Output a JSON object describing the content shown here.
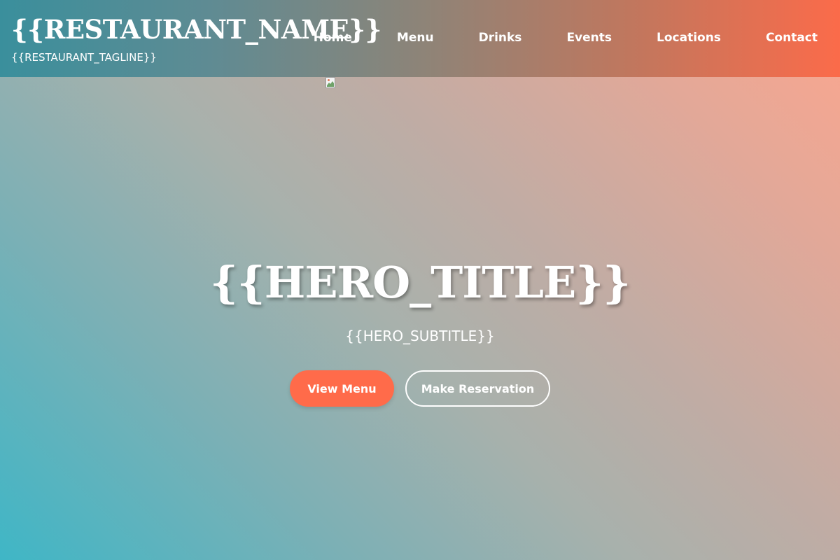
{
  "header": {
    "restaurant_name": "{{RESTAURANT_NAME}}",
    "tagline": "{{RESTAURANT_TAGLINE}}",
    "nav": [
      {
        "label": "Home"
      },
      {
        "label": "Menu"
      },
      {
        "label": "Drinks"
      },
      {
        "label": "Events"
      },
      {
        "label": "Locations"
      },
      {
        "label": "Contact"
      }
    ]
  },
  "hero": {
    "title": "{{HERO_TITLE}}",
    "subtitle": "{{HERO_SUBTITLE}}",
    "primary_button": "View Menu",
    "secondary_button": "Make Reservation",
    "image_icon": "broken-image-icon"
  },
  "colors": {
    "accent": "#ff6b4a",
    "header_start": "#3a8f9c",
    "header_end": "#fb6b4a",
    "bg_teal": "#3fb6c6",
    "bg_peach": "#fda68e"
  }
}
